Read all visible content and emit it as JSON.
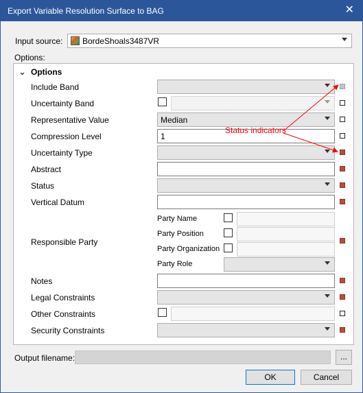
{
  "window": {
    "title": "Export Variable Resolution Surface to BAG",
    "close_glyph": "✕"
  },
  "input": {
    "label": "Input source:",
    "value": "BordeShoals3487VR",
    "icon": "raster-surface-icon"
  },
  "options_label": "Options:",
  "group": {
    "title": "Options",
    "expand_glyph": "⌄"
  },
  "rows": {
    "include_band": "Include Band",
    "uncertainty_band": "Uncertainty Band",
    "representative_value": {
      "label": "Representative Value",
      "value": "Median"
    },
    "compression_level": {
      "label": "Compression Level",
      "value": "1"
    },
    "uncertainty_type": "Uncertainty Type",
    "abstract": "Abstract",
    "status": "Status",
    "vertical_datum": "Vertical Datum",
    "responsible_party": {
      "label": "Responsible Party",
      "party_name": "Party Name",
      "party_position": "Party Position",
      "party_organization": "Party Organization",
      "party_role": "Party Role"
    },
    "notes": "Notes",
    "legal_constraints": "Legal Constraints",
    "other_constraints": "Other Constraints",
    "security_constraints": "Security Constraints"
  },
  "annotation": {
    "text": "Status indicators",
    "color": "#ff0000"
  },
  "output": {
    "label": "Output filename:",
    "browse": "..."
  },
  "buttons": {
    "ok": "OK",
    "cancel": "Cancel"
  },
  "colors": {
    "titlebar": "#2b579a",
    "indicator_red": "#b84d3d"
  }
}
